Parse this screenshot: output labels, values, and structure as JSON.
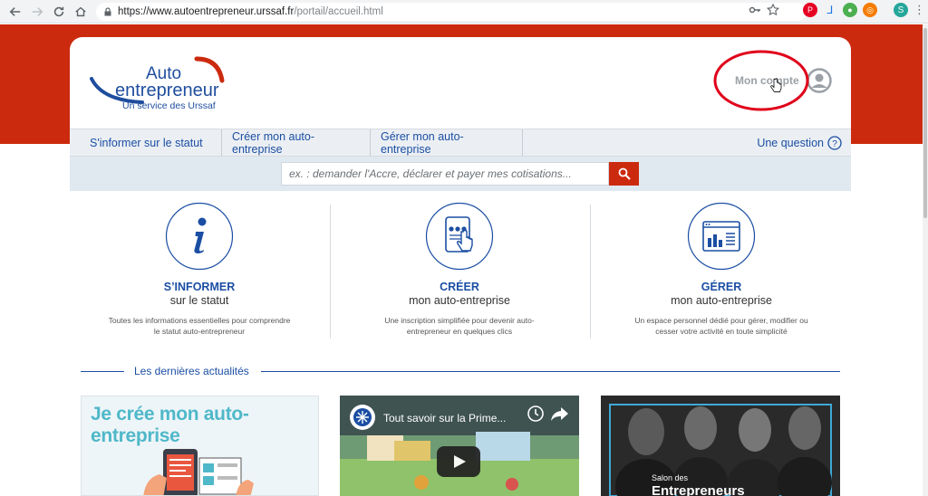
{
  "browser": {
    "url_host": "https://www.autoentrepreneur.urssaf.fr",
    "url_path": "/portail/accueil.html",
    "profile_initial": "S"
  },
  "header": {
    "logo_line1": "Auto",
    "logo_line2": "entrepreneur",
    "logo_sub": "Un service des Urssaf",
    "account_label": "Mon compte"
  },
  "menu": {
    "items": [
      {
        "label": "S'informer sur le statut"
      },
      {
        "label": "Créer mon auto-entreprise"
      },
      {
        "label": "Gérer mon auto-entreprise"
      }
    ],
    "question_label": "Une question"
  },
  "search": {
    "placeholder": "ex. : demander l'Accre, déclarer et payer mes cotisations..."
  },
  "features": [
    {
      "title": "S’INFORMER",
      "sub": "sur le statut",
      "desc": "Toutes les informations essentielles pour comprendre le statut auto-entrepreneur",
      "icon": "info-icon"
    },
    {
      "title": "CRÉER",
      "sub": "mon auto-entreprise",
      "desc": "Une inscription simplifiée pour devenir auto-entrepreneur en quelques clics",
      "icon": "tablet-touch-icon"
    },
    {
      "title": "GÉRER",
      "sub": "mon auto-entreprise",
      "desc": "Un espace personnel dédié pour gérer, modifier ou cesser votre activité en toute simplicité",
      "icon": "dashboard-icon"
    }
  ],
  "news": {
    "title": "Les dernières actualités",
    "cards": [
      {
        "title": "Je crée mon auto-entreprise"
      },
      {
        "title": "Tout savoir sur la Prime..."
      },
      {
        "title_small": "Salon des",
        "title_large": "Entrepreneurs"
      }
    ]
  },
  "colors": {
    "brand_red": "#cc2a0e",
    "brand_blue": "#1b4ea3"
  }
}
